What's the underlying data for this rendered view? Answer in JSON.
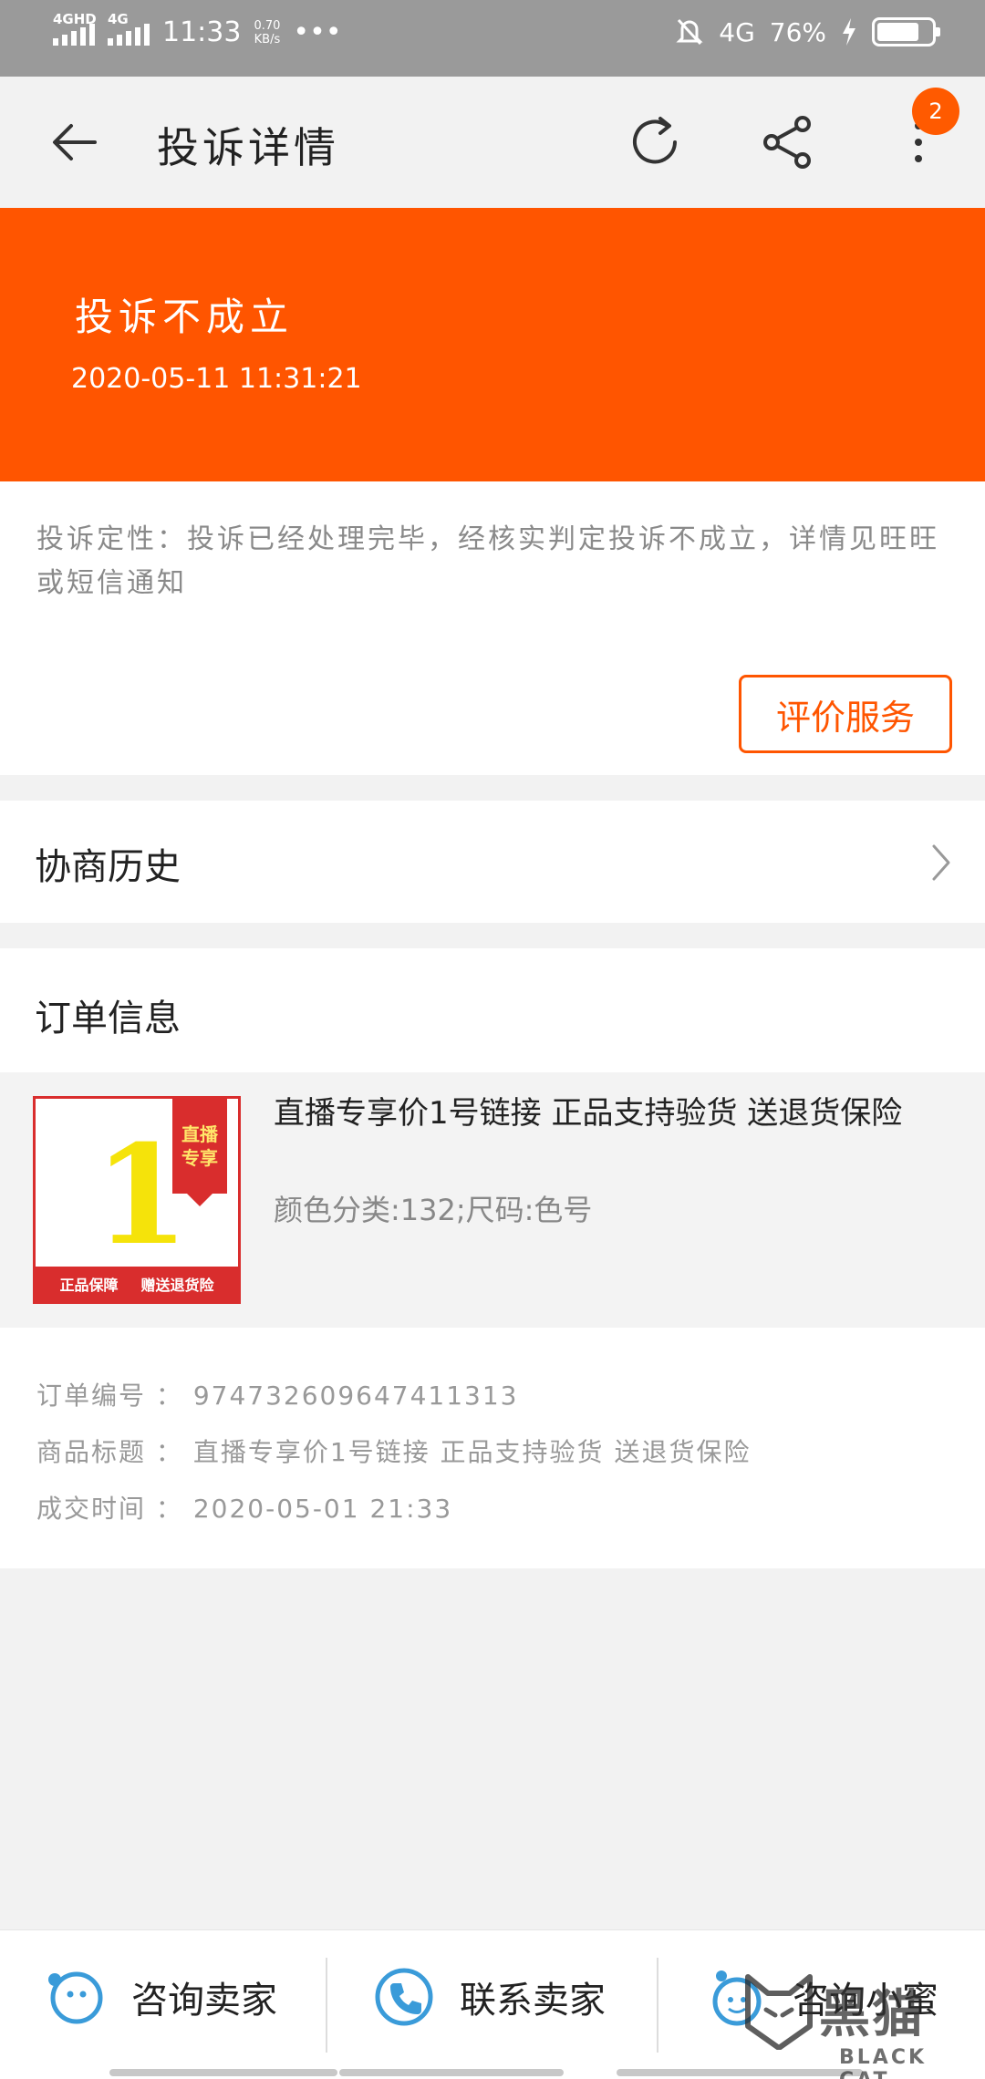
{
  "status_bar": {
    "net1": "4GHD",
    "net2": "4G",
    "time": "11:33",
    "speed_value": "0.70",
    "speed_unit": "KB/s",
    "dots": "•••",
    "net3": "4G",
    "battery": "76%"
  },
  "nav": {
    "title": "投诉详情",
    "badge_count": "2"
  },
  "banner": {
    "result": "投诉不成立",
    "time": "2020-05-11 11:31:21"
  },
  "complaint": {
    "description": "投诉定性：投诉已经处理完毕，经核实判定投诉不成立，详情见旺旺或短信通知",
    "rate_button": "评价服务"
  },
  "history": {
    "label": "协商历史"
  },
  "order": {
    "section_label": "订单信息",
    "product": {
      "thumb_number": "1",
      "thumb_tag_line1": "直播",
      "thumb_tag_line2": "专享",
      "thumb_strip_left": "正品保障",
      "thumb_strip_right": "赠送退货险",
      "name": "直播专享价1号链接 正品支持验货 送退货保险",
      "sku": "颜色分类:132;尺码:色号"
    },
    "info": [
      {
        "label": "订单编号",
        "value": "974732609647411313"
      },
      {
        "label": "商品标题",
        "value": "直播专享价1号链接 正品支持验货 送退货保险"
      },
      {
        "label": "成交时间",
        "value": "2020-05-01 21:33"
      }
    ]
  },
  "bottom_bar": {
    "consult_seller": "咨询卖家",
    "contact_seller": "联系卖家",
    "consult_assistant": "咨询小蜜"
  },
  "watermark": {
    "cn": "黑猫",
    "en": "BLACK CAT"
  },
  "colors": {
    "accent": "#ff5500",
    "status_bar": "#9a9a9a",
    "icon_blue": "#3a9bd9"
  }
}
